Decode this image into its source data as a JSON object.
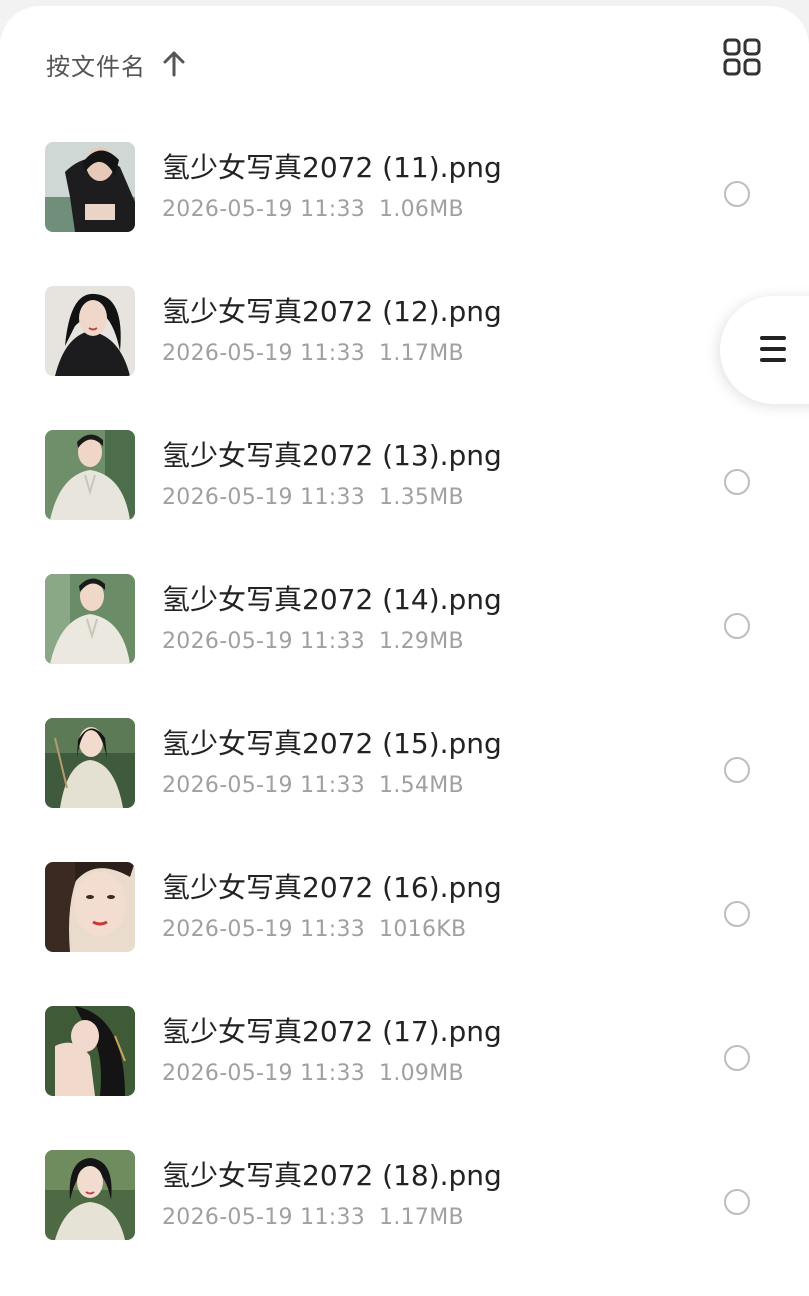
{
  "header": {
    "sort_label": "按文件名",
    "sort_direction_icon": "arrow-up-icon",
    "view_toggle_icon": "grid-view-icon"
  },
  "side_handle": {
    "icon": "menu-icon"
  },
  "files": [
    {
      "name": "氢少女写真2072 (11).png",
      "date": "2026-05-19 11:33",
      "size": "1.06MB",
      "selected": false
    },
    {
      "name": "氢少女写真2072 (12).png",
      "date": "2026-05-19 11:33",
      "size": "1.17MB",
      "selected": false
    },
    {
      "name": "氢少女写真2072 (13).png",
      "date": "2026-05-19 11:33",
      "size": "1.35MB",
      "selected": false
    },
    {
      "name": "氢少女写真2072 (14).png",
      "date": "2026-05-19 11:33",
      "size": "1.29MB",
      "selected": false
    },
    {
      "name": "氢少女写真2072 (15).png",
      "date": "2026-05-19 11:33",
      "size": "1.54MB",
      "selected": false
    },
    {
      "name": "氢少女写真2072 (16).png",
      "date": "2026-05-19 11:33",
      "size": "1016KB",
      "selected": false
    },
    {
      "name": "氢少女写真2072 (17).png",
      "date": "2026-05-19 11:33",
      "size": "1.09MB",
      "selected": false
    },
    {
      "name": "氢少女写真2072 (18).png",
      "date": "2026-05-19 11:33",
      "size": "1.17MB",
      "selected": false
    }
  ],
  "colors": {
    "background": "#ffffff",
    "title_text": "#222222",
    "meta_text": "#a0a0a0",
    "radio_border": "#bdbdbd"
  }
}
